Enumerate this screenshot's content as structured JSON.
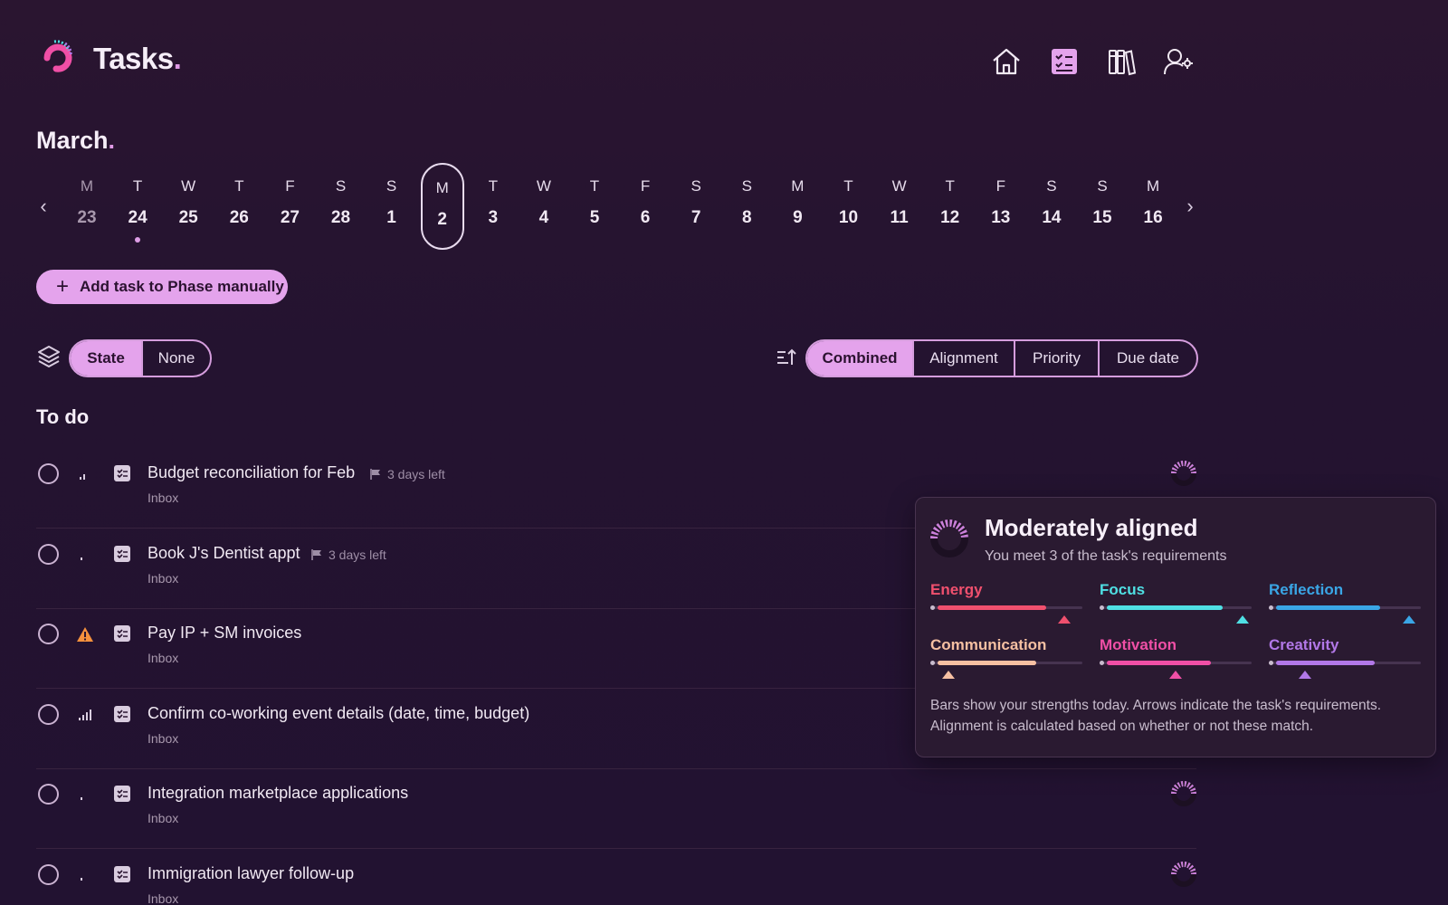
{
  "app": {
    "title": "Tasks",
    "title_dot": "."
  },
  "nav": [
    {
      "name": "home-icon"
    },
    {
      "name": "tasks-icon"
    },
    {
      "name": "library-icon"
    },
    {
      "name": "user-settings-icon"
    }
  ],
  "calendar": {
    "month": "March",
    "month_dot": ".",
    "prev": "‹",
    "next": "›",
    "days": [
      {
        "wd": "M",
        "dn": "23",
        "past": true
      },
      {
        "wd": "T",
        "dn": "24",
        "marker": true
      },
      {
        "wd": "W",
        "dn": "25"
      },
      {
        "wd": "T",
        "dn": "26"
      },
      {
        "wd": "F",
        "dn": "27"
      },
      {
        "wd": "S",
        "dn": "28"
      },
      {
        "wd": "S",
        "dn": "1"
      },
      {
        "wd": "M",
        "dn": "2",
        "selected": true
      },
      {
        "wd": "T",
        "dn": "3"
      },
      {
        "wd": "W",
        "dn": "4"
      },
      {
        "wd": "T",
        "dn": "5"
      },
      {
        "wd": "F",
        "dn": "6"
      },
      {
        "wd": "S",
        "dn": "7"
      },
      {
        "wd": "S",
        "dn": "8"
      },
      {
        "wd": "M",
        "dn": "9"
      },
      {
        "wd": "T",
        "dn": "10"
      },
      {
        "wd": "W",
        "dn": "11"
      },
      {
        "wd": "T",
        "dn": "12"
      },
      {
        "wd": "F",
        "dn": "13"
      },
      {
        "wd": "S",
        "dn": "14"
      },
      {
        "wd": "S",
        "dn": "15"
      },
      {
        "wd": "M",
        "dn": "16"
      }
    ]
  },
  "add_task": {
    "label": "Add task to Phase manually",
    "icon": "plus-icon"
  },
  "grouping": {
    "options": [
      "State",
      "None"
    ],
    "active": "State"
  },
  "sorting": {
    "options": [
      "Combined",
      "Alignment",
      "Priority",
      "Due date"
    ],
    "active": "Combined"
  },
  "section": {
    "title": "To do"
  },
  "tasks": [
    {
      "name": "Budget reconciliation for Feb",
      "due": "3 days left",
      "project": "Inbox",
      "priority": "low"
    },
    {
      "name": "Book J's Dentist appt",
      "due": "3 days left",
      "project": "Inbox",
      "priority": "minimal"
    },
    {
      "name": "Pay IP + SM invoices",
      "due": "",
      "project": "Inbox",
      "priority": "urgent"
    },
    {
      "name": "Confirm co-working event details (date, time, budget)",
      "due": "",
      "project": "Inbox",
      "priority": "high"
    },
    {
      "name": "Integration marketplace applications",
      "due": "",
      "project": "Inbox",
      "priority": "minimal"
    },
    {
      "name": "Immigration lawyer follow-up",
      "due": "",
      "project": "Inbox",
      "priority": "minimal"
    }
  ],
  "alignment_popover": {
    "title": "Moderately aligned",
    "subtitle": "You meet 3 of the task's requirements",
    "metrics": [
      {
        "label": "Energy",
        "color": "#f0506e",
        "strength": 0.75,
        "requirement": 0.88
      },
      {
        "label": "Focus",
        "color": "#4fe0e4",
        "strength": 0.8,
        "requirement": 0.94
      },
      {
        "label": "Reflection",
        "color": "#3aa6e6",
        "strength": 0.72,
        "requirement": 0.92
      },
      {
        "label": "Communication",
        "color": "#f6c0a2",
        "strength": 0.68,
        "requirement": 0.12
      },
      {
        "label": "Motivation",
        "color": "#f04fa6",
        "strength": 0.72,
        "requirement": 0.5
      },
      {
        "label": "Creativity",
        "color": "#b278e8",
        "strength": 0.68,
        "requirement": 0.24
      }
    ],
    "footer": "Bars show your strengths today. Arrows indicate the task's requirements. Alignment is calculated based on whether or not these match."
  },
  "colors": {
    "accent": "#e4a3ec",
    "background": "#241330",
    "warning": "#f5913d"
  }
}
